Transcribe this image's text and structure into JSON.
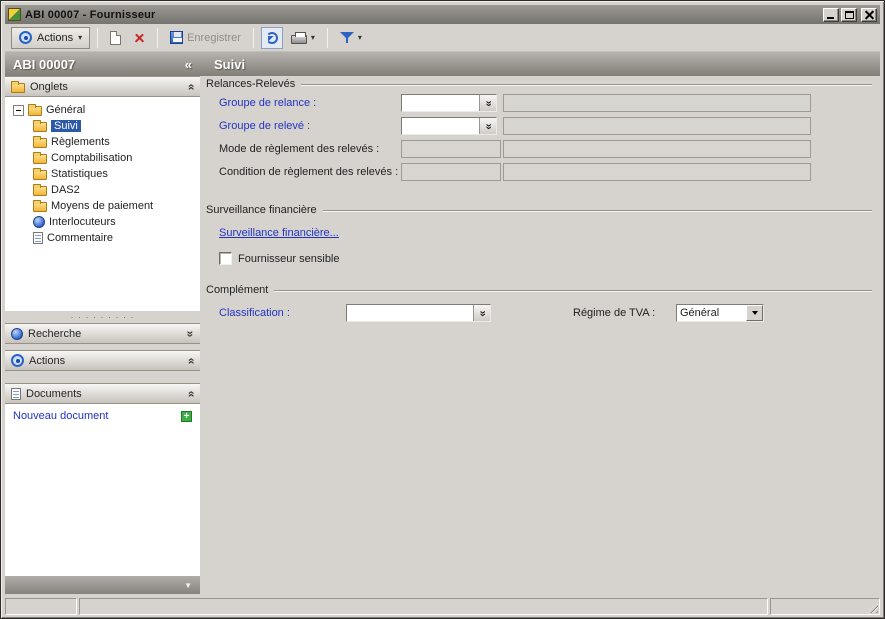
{
  "window": {
    "title": "ABI 00007 -  Fournisseur"
  },
  "toolbar": {
    "actions_label": "Actions",
    "save_label": "Enregistrer"
  },
  "icons": {
    "caret": "▾",
    "chevron_double": "»",
    "collapse": "«",
    "down_arrow": "▼",
    "add": "+"
  },
  "sidebar": {
    "header": "ABI 00007",
    "sections": {
      "onglets": "Onglets",
      "recherche": "Recherche",
      "actions": "Actions",
      "documents": "Documents"
    },
    "tree": {
      "root": "Général",
      "items": [
        {
          "label": "Suivi",
          "selected": true
        },
        {
          "label": "Règlements"
        },
        {
          "label": "Comptabilisation"
        },
        {
          "label": "Statistiques"
        },
        {
          "label": "DAS2"
        },
        {
          "label": "Moyens de paiement"
        },
        {
          "label": "Interlocuteurs"
        },
        {
          "label": "Commentaire"
        }
      ]
    },
    "documents": {
      "new_label": "Nouveau document"
    }
  },
  "main": {
    "title": "Suivi",
    "relances": {
      "title": "Relances-Relevés",
      "rows": [
        {
          "label": "Groupe de relance :",
          "value": "",
          "description": ""
        },
        {
          "label": "Groupe de relevé :",
          "value": "",
          "description": ""
        },
        {
          "label": "Mode de règlement des relevés :",
          "value": "",
          "description": ""
        },
        {
          "label": "Condition de règlement des relevés :",
          "value": "",
          "description": ""
        }
      ]
    },
    "surveillance": {
      "title": "Surveillance financière",
      "link": "Surveillance financière...",
      "checkbox_label": "Fournisseur sensible",
      "checked": false
    },
    "complement": {
      "title": "Complément",
      "classification_label": "Classification :",
      "classification_value": "",
      "tva_label": "Régime de TVA :",
      "tva_value": "Général"
    }
  },
  "statusbar": {
    "pane1": "",
    "pane2": "",
    "pane3": ""
  },
  "colors": {
    "link_blue": "#2233c4",
    "selection_blue": "#2c58a8",
    "accent_blue": "#2b62c6",
    "green_plus": "#3fae46",
    "delete_red": "#c92a2a",
    "header_gradient_top": "#b6b3ae",
    "header_gradient_bottom": "#827f79"
  }
}
